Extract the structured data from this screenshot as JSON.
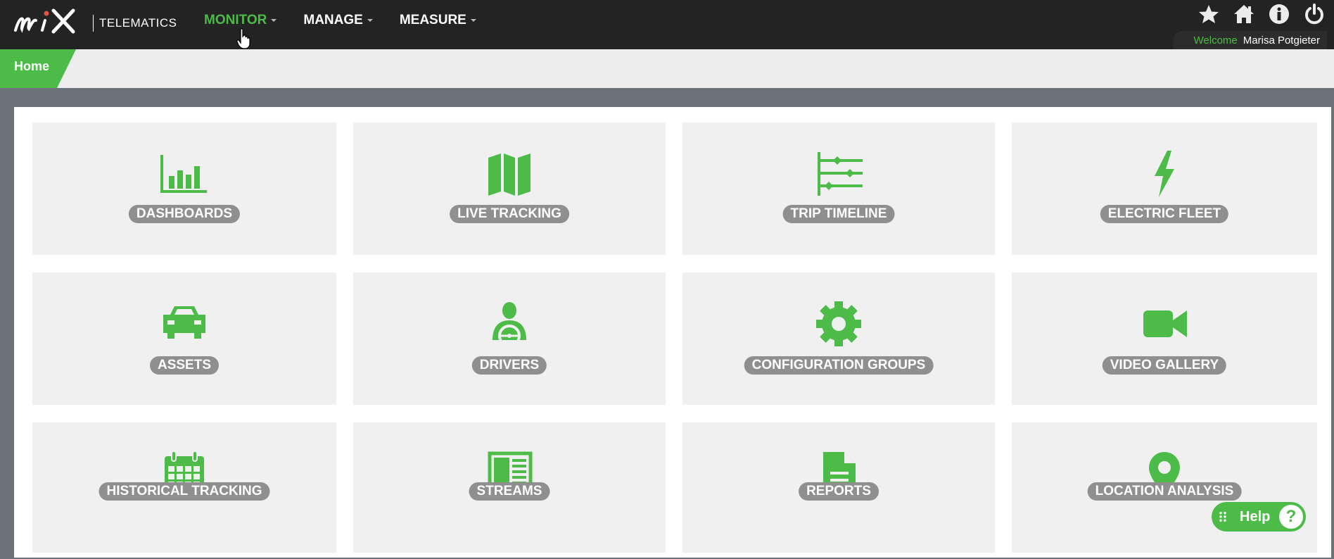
{
  "brand": {
    "logo_text": "mix",
    "product": "TELEMATICS",
    "accent_color": "#4cbb47"
  },
  "nav": {
    "items": [
      {
        "label": "MONITOR",
        "active": true
      },
      {
        "label": "MANAGE",
        "active": false
      },
      {
        "label": "MEASURE",
        "active": false
      }
    ]
  },
  "top_icons": [
    "star-icon",
    "home-icon",
    "info-icon",
    "power-icon"
  ],
  "user": {
    "welcome": "Welcome",
    "name": "Marisa Potgieter"
  },
  "breadcrumb": {
    "home": "Home"
  },
  "tiles": [
    {
      "label": "DASHBOARDS",
      "icon": "bar-chart-icon"
    },
    {
      "label": "LIVE TRACKING",
      "icon": "map-icon"
    },
    {
      "label": "TRIP TIMELINE",
      "icon": "timeline-icon"
    },
    {
      "label": "ELECTRIC FLEET",
      "icon": "lightning-bolt-icon"
    },
    {
      "label": "ASSETS",
      "icon": "car-icon"
    },
    {
      "label": "DRIVERS",
      "icon": "driver-icon"
    },
    {
      "label": "CONFIGURATION GROUPS",
      "icon": "gear-icon"
    },
    {
      "label": "VIDEO GALLERY",
      "icon": "video-camera-icon"
    },
    {
      "label": "HISTORICAL TRACKING",
      "icon": "calendar-icon"
    },
    {
      "label": "STREAMS",
      "icon": "streams-icon"
    },
    {
      "label": "REPORTS",
      "icon": "document-icon"
    },
    {
      "label": "LOCATION ANALYSIS",
      "icon": "map-pin-icon"
    }
  ],
  "help": {
    "label": "Help",
    "symbol": "?"
  }
}
